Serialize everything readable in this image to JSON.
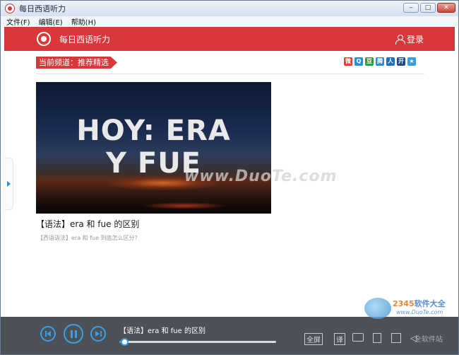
{
  "window": {
    "title": "每日西语听力",
    "controls": [
      "‒",
      "□",
      "✕"
    ]
  },
  "menu": [
    "文件(F)",
    "编辑(E)",
    "帮助(H)"
  ],
  "header": {
    "brand": "每日西语听力",
    "login_label": "登录"
  },
  "channel": {
    "label": "当前频道：推荐精选"
  },
  "share_icons": [
    {
      "name": "weibo-icon",
      "glyph": "微",
      "color": "#e0412f"
    },
    {
      "name": "qzone-icon",
      "glyph": "Q",
      "color": "#2a8fd6"
    },
    {
      "name": "douban-icon",
      "glyph": "豆",
      "color": "#2f9b3a"
    },
    {
      "name": "tencent-icon",
      "glyph": "腾",
      "color": "#2a8fd6"
    },
    {
      "name": "renren-icon",
      "glyph": "人",
      "color": "#1f6fbf"
    },
    {
      "name": "kaixin-icon",
      "glyph": "开",
      "color": "#234a8f"
    },
    {
      "name": "star-icon",
      "glyph": "★",
      "color": "#39a0d8"
    }
  ],
  "article": {
    "thumbnail_line1": "HOY: ERA",
    "thumbnail_line2": "Y FUE",
    "title": "【语法】era 和 fue 的区别",
    "subtitle": "【西语语法】era 和 fue 到底怎么区分？"
  },
  "watermark": "www.DuoTe.com",
  "player": {
    "now_playing": "【语法】era 和 fue 的区别",
    "progress": 0.03,
    "fullscreen_label": "全屏",
    "translate_label": "译"
  },
  "corner_watermark": {
    "brand_main": "2345",
    "brand_rest": "软件大全",
    "url": "www.DuoTe.com",
    "tail": "全软件站"
  }
}
